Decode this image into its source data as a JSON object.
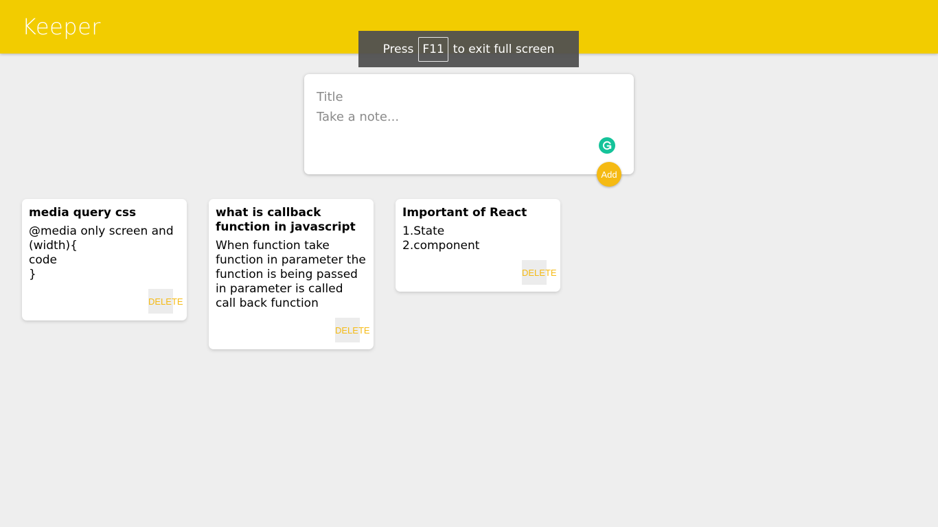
{
  "app": {
    "title": "Keeper"
  },
  "fullscreen_toast": {
    "prefix": "Press",
    "key": "F11",
    "suffix": "to exit full screen"
  },
  "create_area": {
    "title_placeholder": "Title",
    "content_placeholder": "Take a note...",
    "add_label": "Add"
  },
  "notes": [
    {
      "title": "media query css",
      "content": "@media only screen and (width){\ncode\n}",
      "delete_label": "DELETE"
    },
    {
      "title": "what is callback function in javascript",
      "content": "When function take function in parameter the function is being passed in parameter is called call back function",
      "delete_label": "DELETE"
    },
    {
      "title": "Important of React",
      "content": "1.State\n2.component",
      "delete_label": "DELETE"
    }
  ],
  "colors": {
    "header": "#f2cc00",
    "accent": "#f5ba13",
    "background": "#eeeeee",
    "grammarly": "#15c39a"
  },
  "icons": {
    "grammarly": "grammarly-icon"
  }
}
